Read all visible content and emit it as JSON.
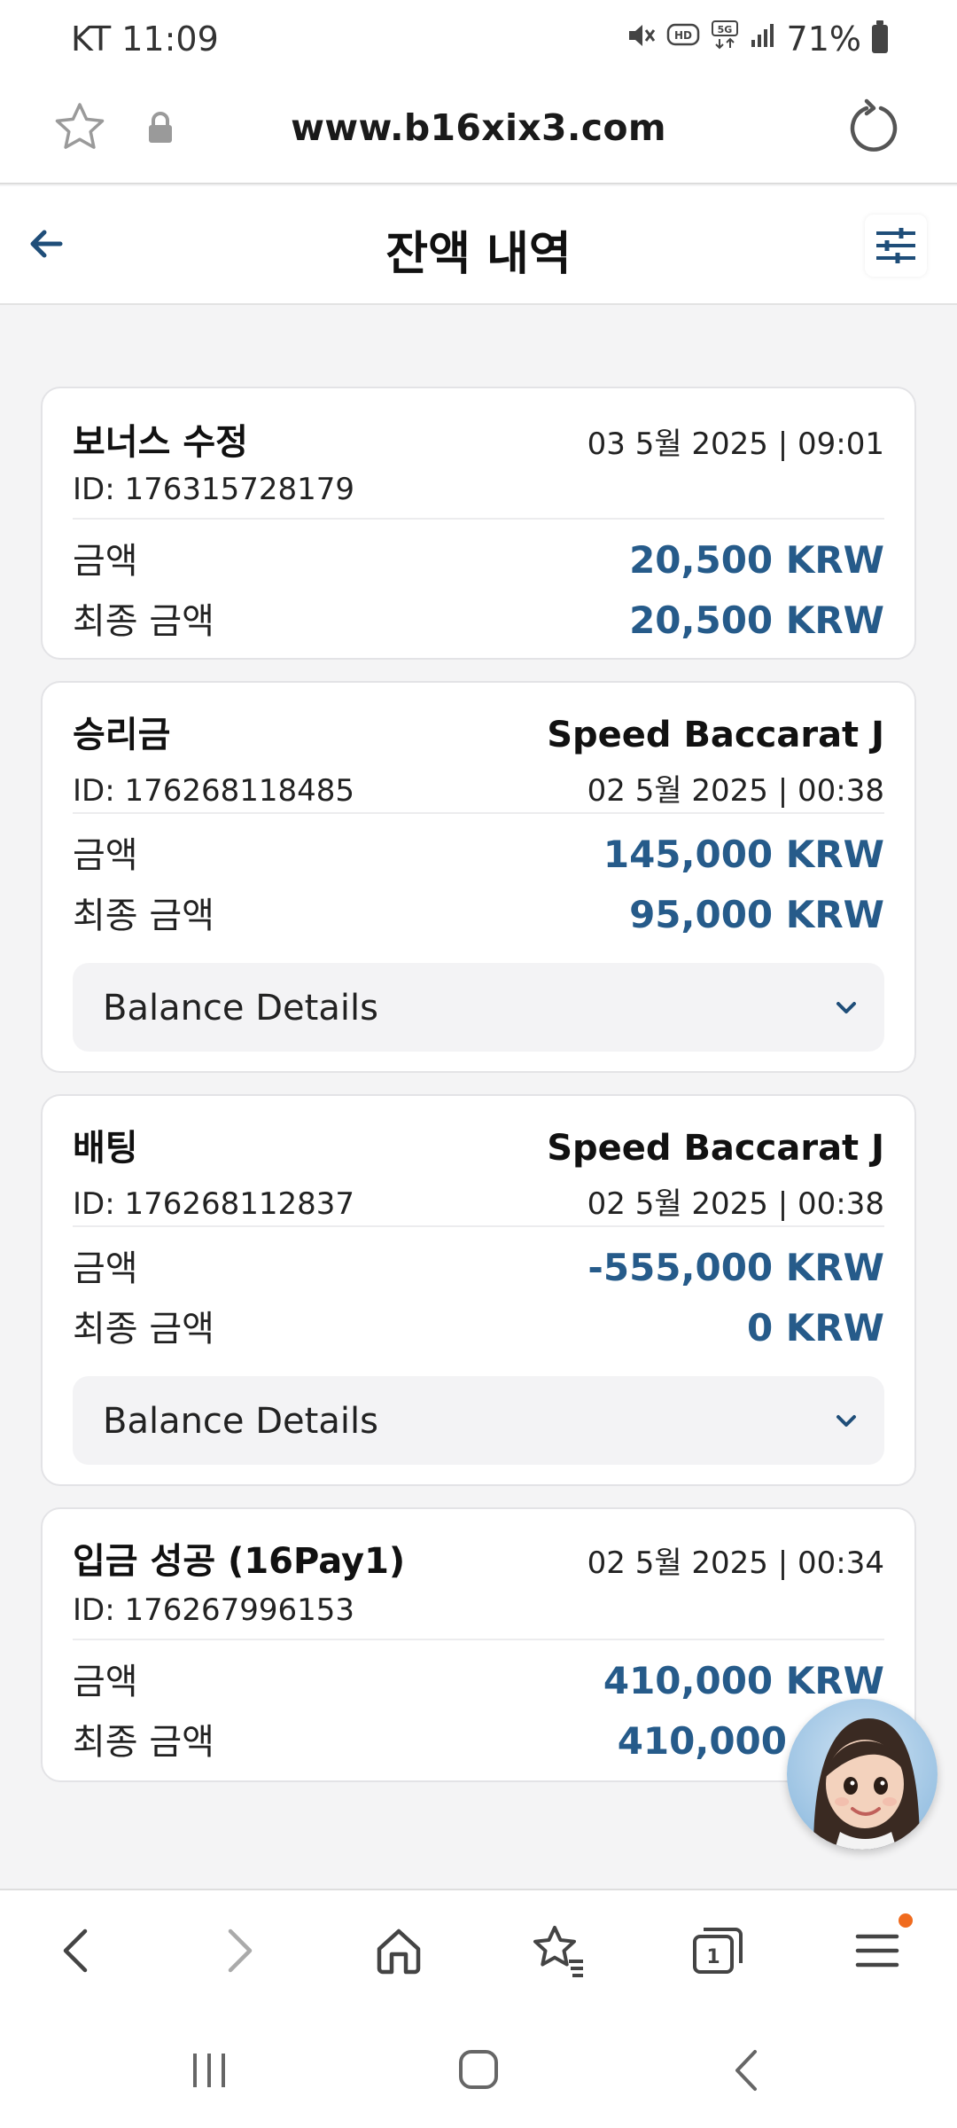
{
  "status_bar": {
    "carrier_time": "KT 11:09",
    "battery": "71%",
    "icons": [
      "mute-icon",
      "hd-icon",
      "5g-icon",
      "signal-icon",
      "battery-icon"
    ]
  },
  "browser": {
    "url": "www.b16xix3.com",
    "icons": [
      "star-icon",
      "lock-icon",
      "reload-icon"
    ]
  },
  "header": {
    "title": "잔액 내역"
  },
  "cards": [
    {
      "title": "보너스 수정",
      "date": "03 5월 2025 | 09:01",
      "id": "ID: 176315728179",
      "amount_label": "금액",
      "amount": "20,500 KRW",
      "final_label": "최종 금액",
      "final_amount": "20,500 KRW"
    },
    {
      "title": "승리금",
      "game": "Speed Baccarat J",
      "id": "ID: 176268118485",
      "date": "02 5월 2025 | 00:38",
      "amount_label": "금액",
      "amount": "145,000 KRW",
      "final_label": "최종 금액",
      "final_amount": "95,000 KRW",
      "details_label": "Balance Details"
    },
    {
      "title": "배팅",
      "game": "Speed Baccarat J",
      "id": "ID: 176268112837",
      "date": "02 5월 2025 | 00:38",
      "amount_label": "금액",
      "amount": "-555,000 KRW",
      "final_label": "최종 금액",
      "final_amount": "0 KRW",
      "details_label": "Balance Details"
    },
    {
      "title": "입금 성공 (16Pay1)",
      "date": "02 5월 2025 | 00:34",
      "id": "ID: 176267996153",
      "amount_label": "금액",
      "amount": "410,000 KRW",
      "final_label": "최종 금액",
      "final_amount": "410,000"
    }
  ],
  "colors": {
    "accent_blue": "#265b8a",
    "notification_dot": "#f06b1e",
    "background": "#f4f4f5"
  }
}
